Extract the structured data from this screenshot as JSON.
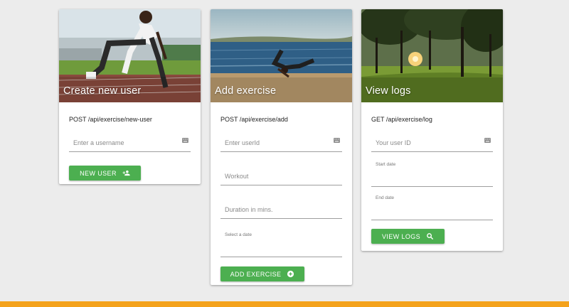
{
  "cards": [
    {
      "title": "Create new user",
      "endpoint": "POST /api/exercise/new-user",
      "fields": {
        "username": {
          "placeholder": "Enter a username"
        }
      },
      "button": {
        "label": "NEW USER",
        "icon": "person-add-icon"
      }
    },
    {
      "title": "Add exercise",
      "endpoint": "POST /api/exercise/add",
      "fields": {
        "userid": {
          "placeholder": "Enter userId"
        },
        "workout": {
          "placeholder": "Workout"
        },
        "duration": {
          "placeholder": "Duration in mins."
        },
        "date": {
          "label": "Select a date"
        }
      },
      "button": {
        "label": "ADD EXERCISE",
        "icon": "add-circle-icon"
      }
    },
    {
      "title": "View logs",
      "endpoint": "GET /api/exercise/log",
      "fields": {
        "userid": {
          "placeholder": "Your user ID"
        },
        "start": {
          "label": "Start date"
        },
        "end": {
          "label": "End date"
        }
      },
      "button": {
        "label": "VIEW LOGS",
        "icon": "search-icon"
      }
    }
  ],
  "colors": {
    "button": "#4caf50",
    "bottom_bar": "#f4a21c",
    "background": "#ececec"
  }
}
